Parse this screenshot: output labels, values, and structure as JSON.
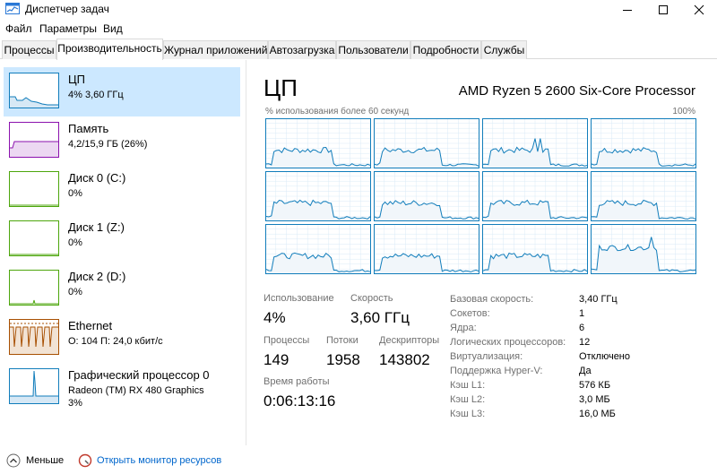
{
  "window": {
    "title": "Диспетчер задач"
  },
  "icons": {
    "app": "task-manager-icon",
    "minimize": "minimize-icon",
    "maximize": "maximize-icon",
    "close": "close-icon",
    "less": "chevron-up-icon",
    "monitor": "resource-monitor-icon"
  },
  "menu": [
    "Файл",
    "Параметры",
    "Вид"
  ],
  "tabs": [
    "Процессы",
    "Производительность",
    "Журнал приложений",
    "Автозагрузка",
    "Пользователи",
    "Подробности",
    "Службы"
  ],
  "active_tab": 1,
  "colors": {
    "cpu": "#117dbb",
    "memory": "#8b12ae",
    "disk": "#4da60c",
    "ethernet": "#a74f01",
    "gpu": "#117dbb",
    "selection": "#cce8ff"
  },
  "sidebar": [
    {
      "name": "ЦП",
      "sub1": "4% 3,60 ГГц",
      "sub2": ""
    },
    {
      "name": "Память",
      "sub1": "4,2/15,9 ГБ (26%)",
      "sub2": ""
    },
    {
      "name": "Диск 0 (C:)",
      "sub1": "0%",
      "sub2": ""
    },
    {
      "name": "Диск 1 (Z:)",
      "sub1": "0%",
      "sub2": ""
    },
    {
      "name": "Диск 2 (D:)",
      "sub1": "0%",
      "sub2": ""
    },
    {
      "name": "Ethernet",
      "sub1": "О: 104 П: 24,0 кбит/с",
      "sub2": ""
    },
    {
      "name": "Графический процессор 0",
      "sub1": "Radeon (TM) RX 480 Graphics",
      "sub2": "3%"
    }
  ],
  "main": {
    "title": "ЦП",
    "cpu_name": "AMD Ryzen 5 2600 Six-Core Processor",
    "graph_label": "% использования более 60 секунд",
    "graph_max": "100%",
    "stats": {
      "usage_label": "Использование",
      "usage_value": "4%",
      "speed_label": "Скорость",
      "speed_value": "3,60 ГГц",
      "processes_label": "Процессы",
      "processes_value": "149",
      "threads_label": "Потоки",
      "threads_value": "1958",
      "handles_label": "Дескрипторы",
      "handles_value": "143802",
      "uptime_label": "Время работы",
      "uptime_value": "0:06:13:16"
    },
    "info": [
      {
        "label": "Базовая скорость:",
        "value": "3,40 ГГц"
      },
      {
        "label": "Сокетов:",
        "value": "1"
      },
      {
        "label": "Ядра:",
        "value": "6"
      },
      {
        "label": "Логических процессоров:",
        "value": "12"
      },
      {
        "label": "Виртуализация:",
        "value": "Отключено"
      },
      {
        "label": "Поддержка Hyper-V:",
        "value": "Да"
      },
      {
        "label": "Кэш L1:",
        "value": "576 КБ"
      },
      {
        "label": "Кэш L2:",
        "value": "3,0 МБ"
      },
      {
        "label": "Кэш L3:",
        "value": "16,0 МБ"
      }
    ]
  },
  "bottom": {
    "less": "Меньше",
    "open_monitor": "Открыть монитор ресурсов"
  }
}
